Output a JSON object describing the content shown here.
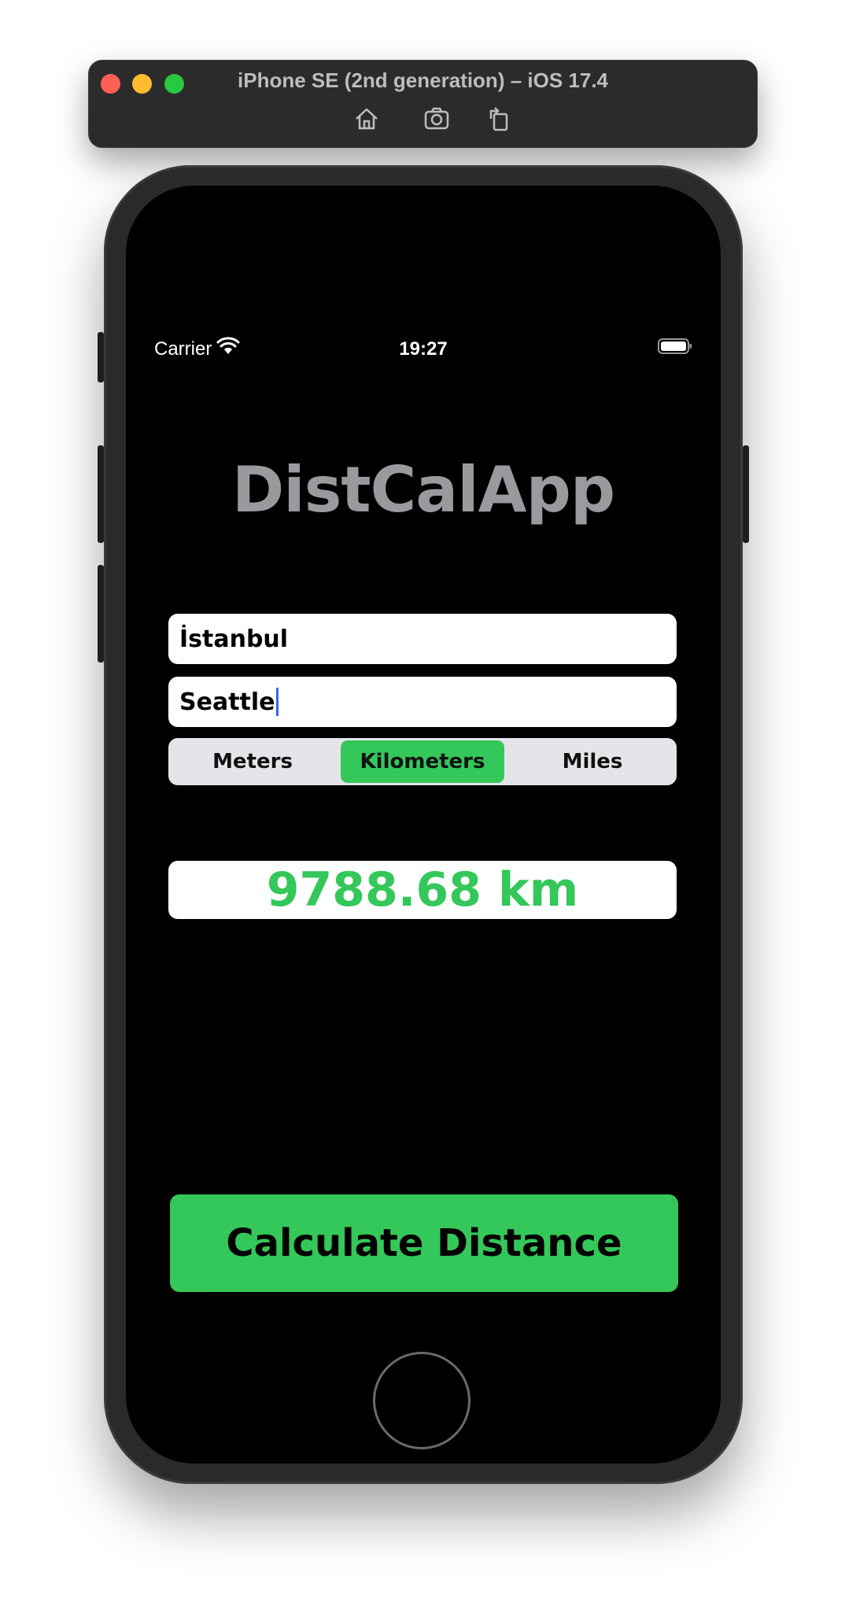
{
  "window": {
    "title": "iPhone SE (2nd generation) – iOS 17.4",
    "tools": [
      "home-icon",
      "screenshot-icon",
      "rotate-icon"
    ]
  },
  "status_bar": {
    "carrier": "Carrier",
    "time": "19:27"
  },
  "app": {
    "title": "DistCalApp",
    "from_value": "İstanbul",
    "to_value": "Seattle",
    "units": {
      "options": [
        "Meters",
        "Kilometers",
        "Miles"
      ],
      "selected": "Kilometers"
    },
    "result": "9788.68 km",
    "calculate_label": "Calculate Distance"
  },
  "colors": {
    "accent_green": "#34c759",
    "title_gray": "#9a9a9e",
    "caret_blue": "#3b63f0"
  }
}
